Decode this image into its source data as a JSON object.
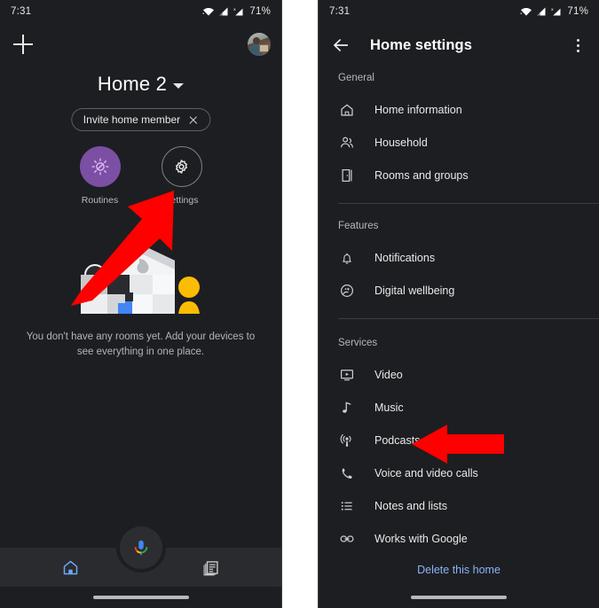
{
  "status_bar": {
    "time": "7:31",
    "battery": "71%",
    "icons": [
      "wifi-icon",
      "signal-icon",
      "signal-no-sim-icon"
    ]
  },
  "left_phone": {
    "topbar": {
      "add_icon": "plus-icon",
      "avatar_label": "account-avatar"
    },
    "home_title": "Home 2",
    "home_title_caret": "chevron-down-icon",
    "invite_chip": {
      "label": "Invite home member",
      "dismiss_icon": "close-icon"
    },
    "quick_actions": [
      {
        "label": "Routines",
        "icon": "routines-icon",
        "color": "#7b4fa4"
      },
      {
        "label": "Settings",
        "icon": "gear-icon",
        "color": "#7c7d80"
      }
    ],
    "illustration": "empty-home-illustration",
    "empty_text": "You don't have any rooms yet. Add your devices to see everything in one place.",
    "mic_button": "google-assistant-mic-icon",
    "bottom_nav": [
      {
        "icon": "home-icon",
        "active": true,
        "color": "#6aa9f4"
      },
      {
        "icon": "feed-icon",
        "active": false,
        "color": "#c9cacc"
      }
    ]
  },
  "right_phone": {
    "appbar": {
      "back_icon": "back-arrow-icon",
      "title": "Home settings",
      "overflow_icon": "more-vert-icon"
    },
    "sections": [
      {
        "title": "General",
        "items": [
          {
            "label": "Home information",
            "icon": "home-outline-icon"
          },
          {
            "label": "Household",
            "icon": "people-icon"
          },
          {
            "label": "Rooms and groups",
            "icon": "door-icon"
          }
        ]
      },
      {
        "title": "Features",
        "items": [
          {
            "label": "Notifications",
            "icon": "bell-icon"
          },
          {
            "label": "Digital wellbeing",
            "icon": "wellbeing-icon"
          }
        ]
      },
      {
        "title": "Services",
        "items": [
          {
            "label": "Video",
            "icon": "video-icon"
          },
          {
            "label": "Music",
            "icon": "music-note-icon"
          },
          {
            "label": "Podcasts",
            "icon": "podcast-icon"
          },
          {
            "label": "Voice and video calls",
            "icon": "phone-icon"
          },
          {
            "label": "Notes and lists",
            "icon": "list-icon"
          },
          {
            "label": "Works with Google",
            "icon": "link-icon"
          }
        ]
      }
    ],
    "delete_link": "Delete this home",
    "gesture_bar": "gesture-bar"
  },
  "annotations": [
    {
      "name": "arrow-pointing-to-settings",
      "color": "#ff0000",
      "direction": "up-right"
    },
    {
      "name": "arrow-pointing-to-podcasts",
      "color": "#ff0000",
      "direction": "left"
    }
  ]
}
